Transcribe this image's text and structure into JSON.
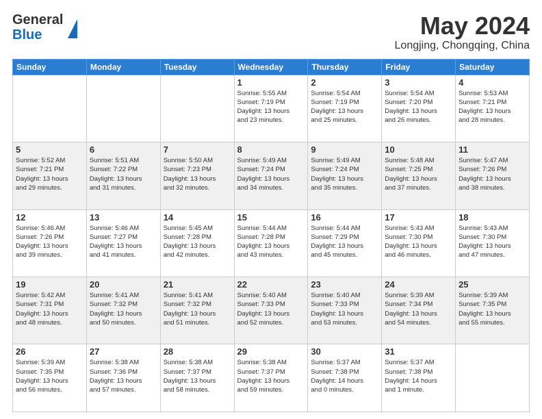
{
  "header": {
    "logo_general": "General",
    "logo_blue": "Blue",
    "month": "May 2024",
    "location": "Longjing, Chongqing, China"
  },
  "weekdays": [
    "Sunday",
    "Monday",
    "Tuesday",
    "Wednesday",
    "Thursday",
    "Friday",
    "Saturday"
  ],
  "rows": [
    {
      "shade": "white",
      "cells": [
        {
          "date": "",
          "info": ""
        },
        {
          "date": "",
          "info": ""
        },
        {
          "date": "",
          "info": ""
        },
        {
          "date": "1",
          "info": "Sunrise: 5:55 AM\nSunset: 7:19 PM\nDaylight: 13 hours\nand 23 minutes."
        },
        {
          "date": "2",
          "info": "Sunrise: 5:54 AM\nSunset: 7:19 PM\nDaylight: 13 hours\nand 25 minutes."
        },
        {
          "date": "3",
          "info": "Sunrise: 5:54 AM\nSunset: 7:20 PM\nDaylight: 13 hours\nand 26 minutes."
        },
        {
          "date": "4",
          "info": "Sunrise: 5:53 AM\nSunset: 7:21 PM\nDaylight: 13 hours\nand 28 minutes."
        }
      ]
    },
    {
      "shade": "shaded",
      "cells": [
        {
          "date": "5",
          "info": "Sunrise: 5:52 AM\nSunset: 7:21 PM\nDaylight: 13 hours\nand 29 minutes."
        },
        {
          "date": "6",
          "info": "Sunrise: 5:51 AM\nSunset: 7:22 PM\nDaylight: 13 hours\nand 31 minutes."
        },
        {
          "date": "7",
          "info": "Sunrise: 5:50 AM\nSunset: 7:23 PM\nDaylight: 13 hours\nand 32 minutes."
        },
        {
          "date": "8",
          "info": "Sunrise: 5:49 AM\nSunset: 7:24 PM\nDaylight: 13 hours\nand 34 minutes."
        },
        {
          "date": "9",
          "info": "Sunrise: 5:49 AM\nSunset: 7:24 PM\nDaylight: 13 hours\nand 35 minutes."
        },
        {
          "date": "10",
          "info": "Sunrise: 5:48 AM\nSunset: 7:25 PM\nDaylight: 13 hours\nand 37 minutes."
        },
        {
          "date": "11",
          "info": "Sunrise: 5:47 AM\nSunset: 7:26 PM\nDaylight: 13 hours\nand 38 minutes."
        }
      ]
    },
    {
      "shade": "white",
      "cells": [
        {
          "date": "12",
          "info": "Sunrise: 5:46 AM\nSunset: 7:26 PM\nDaylight: 13 hours\nand 39 minutes."
        },
        {
          "date": "13",
          "info": "Sunrise: 5:46 AM\nSunset: 7:27 PM\nDaylight: 13 hours\nand 41 minutes."
        },
        {
          "date": "14",
          "info": "Sunrise: 5:45 AM\nSunset: 7:28 PM\nDaylight: 13 hours\nand 42 minutes."
        },
        {
          "date": "15",
          "info": "Sunrise: 5:44 AM\nSunset: 7:28 PM\nDaylight: 13 hours\nand 43 minutes."
        },
        {
          "date": "16",
          "info": "Sunrise: 5:44 AM\nSunset: 7:29 PM\nDaylight: 13 hours\nand 45 minutes."
        },
        {
          "date": "17",
          "info": "Sunrise: 5:43 AM\nSunset: 7:30 PM\nDaylight: 13 hours\nand 46 minutes."
        },
        {
          "date": "18",
          "info": "Sunrise: 5:43 AM\nSunset: 7:30 PM\nDaylight: 13 hours\nand 47 minutes."
        }
      ]
    },
    {
      "shade": "shaded",
      "cells": [
        {
          "date": "19",
          "info": "Sunrise: 5:42 AM\nSunset: 7:31 PM\nDaylight: 13 hours\nand 48 minutes."
        },
        {
          "date": "20",
          "info": "Sunrise: 5:41 AM\nSunset: 7:32 PM\nDaylight: 13 hours\nand 50 minutes."
        },
        {
          "date": "21",
          "info": "Sunrise: 5:41 AM\nSunset: 7:32 PM\nDaylight: 13 hours\nand 51 minutes."
        },
        {
          "date": "22",
          "info": "Sunrise: 5:40 AM\nSunset: 7:33 PM\nDaylight: 13 hours\nand 52 minutes."
        },
        {
          "date": "23",
          "info": "Sunrise: 5:40 AM\nSunset: 7:33 PM\nDaylight: 13 hours\nand 53 minutes."
        },
        {
          "date": "24",
          "info": "Sunrise: 5:39 AM\nSunset: 7:34 PM\nDaylight: 13 hours\nand 54 minutes."
        },
        {
          "date": "25",
          "info": "Sunrise: 5:39 AM\nSunset: 7:35 PM\nDaylight: 13 hours\nand 55 minutes."
        }
      ]
    },
    {
      "shade": "white",
      "cells": [
        {
          "date": "26",
          "info": "Sunrise: 5:39 AM\nSunset: 7:35 PM\nDaylight: 13 hours\nand 56 minutes."
        },
        {
          "date": "27",
          "info": "Sunrise: 5:38 AM\nSunset: 7:36 PM\nDaylight: 13 hours\nand 57 minutes."
        },
        {
          "date": "28",
          "info": "Sunrise: 5:38 AM\nSunset: 7:37 PM\nDaylight: 13 hours\nand 58 minutes."
        },
        {
          "date": "29",
          "info": "Sunrise: 5:38 AM\nSunset: 7:37 PM\nDaylight: 13 hours\nand 59 minutes."
        },
        {
          "date": "30",
          "info": "Sunrise: 5:37 AM\nSunset: 7:38 PM\nDaylight: 14 hours\nand 0 minutes."
        },
        {
          "date": "31",
          "info": "Sunrise: 5:37 AM\nSunset: 7:38 PM\nDaylight: 14 hours\nand 1 minute."
        },
        {
          "date": "",
          "info": ""
        }
      ]
    }
  ]
}
